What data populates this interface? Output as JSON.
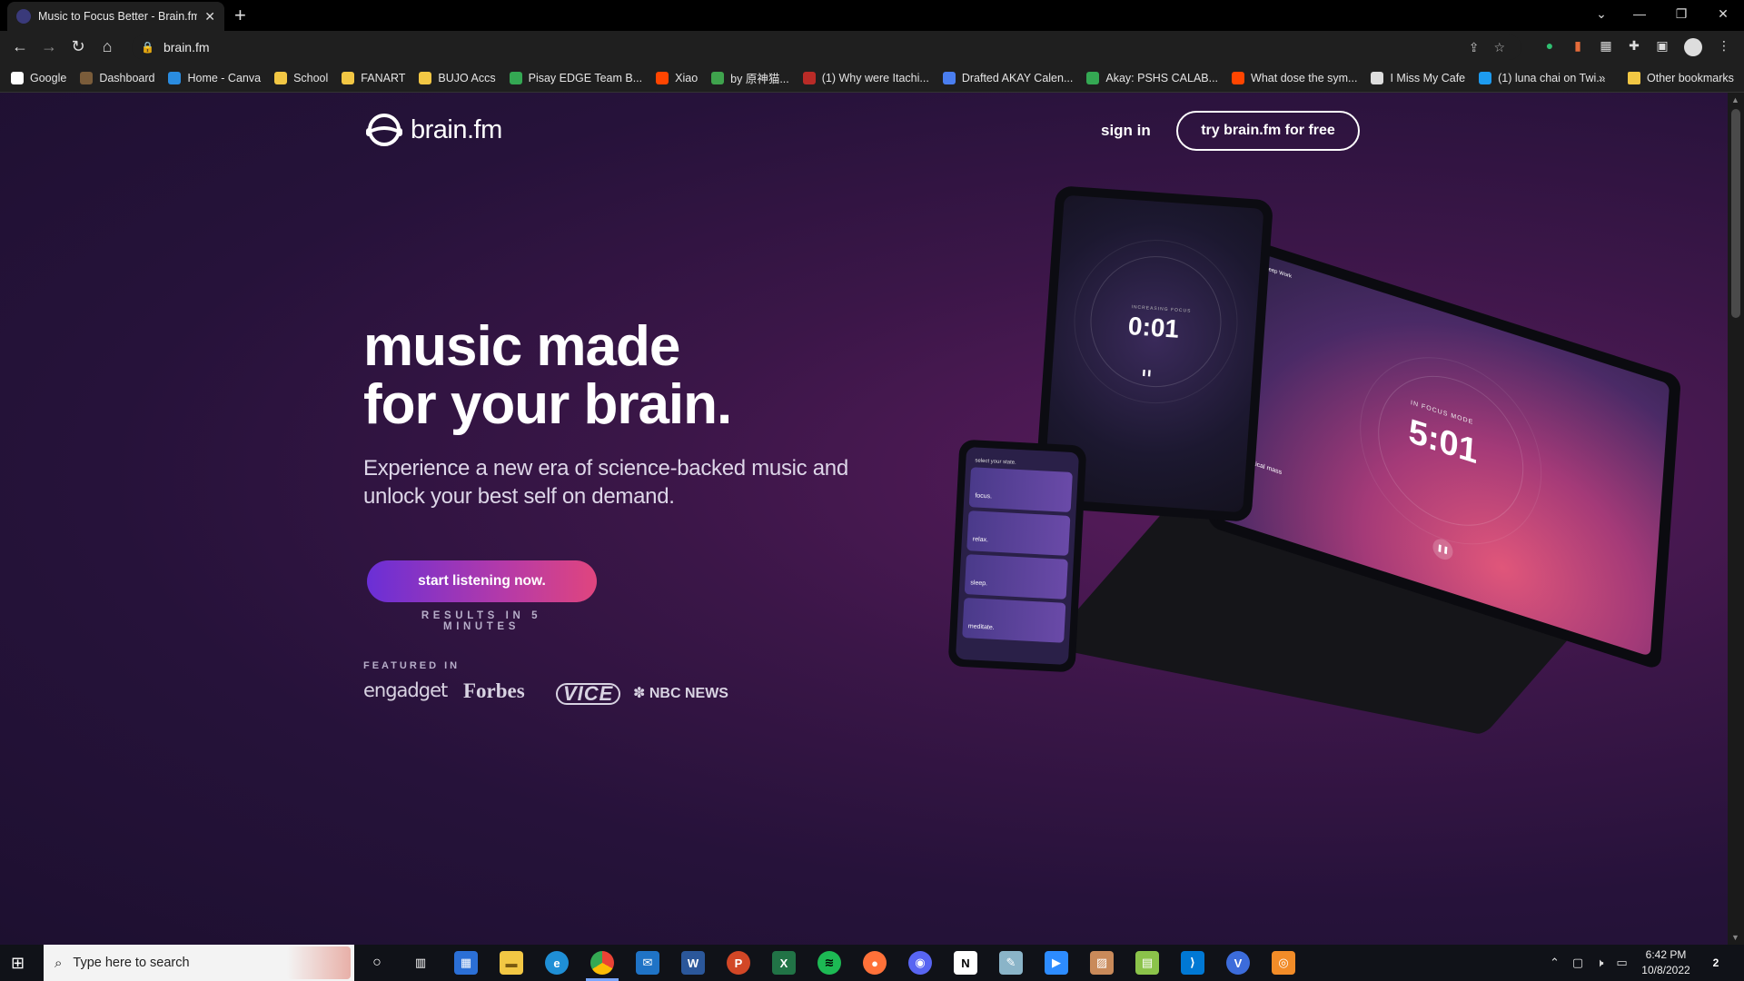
{
  "browser": {
    "tab_title": "Music to Focus Better - Brain.fm",
    "tab_close": "✕",
    "new_tab": "+",
    "url": "brain.fm",
    "bookmarks": [
      {
        "label": "Google",
        "icon": "google-icon",
        "color": "#ffffff"
      },
      {
        "label": "Dashboard",
        "icon": "dashboard-icon",
        "color": "#7a5c3a"
      },
      {
        "label": "Home - Canva",
        "icon": "canva-icon",
        "color": "#2a8ce0"
      },
      {
        "label": "School",
        "icon": "folder-icon",
        "color": "#f2c744"
      },
      {
        "label": "FANART",
        "icon": "folder-icon",
        "color": "#f2c744"
      },
      {
        "label": "BUJO Accs",
        "icon": "folder-icon",
        "color": "#f2c744"
      },
      {
        "label": "Pisay EDGE Team B...",
        "icon": "drive-icon",
        "color": "#34a853"
      },
      {
        "label": "Xiao",
        "icon": "reddit-icon",
        "color": "#ff4500"
      },
      {
        "label": "by 原神猫...",
        "icon": "leaf-icon",
        "color": "#3fa34d"
      },
      {
        "label": "(1) Why were Itachi...",
        "icon": "quora-icon",
        "color": "#b92b27"
      },
      {
        "label": "Drafted AKAY Calen...",
        "icon": "docs-icon",
        "color": "#4a7ef0"
      },
      {
        "label": "Akay: PSHS CALAB...",
        "icon": "drive-icon",
        "color": "#34a853"
      },
      {
        "label": "What dose the sym...",
        "icon": "reddit-icon",
        "color": "#ff4500"
      },
      {
        "label": "I Miss My Cafe",
        "icon": "game-icon",
        "color": "#dddddd"
      },
      {
        "label": "(1) luna chai on Twi...",
        "icon": "twitter-icon",
        "color": "#1d9bf0"
      }
    ],
    "bookmarks_overflow": "»",
    "other_bookmarks": "Other bookmarks"
  },
  "page": {
    "logo_text": "brain.fm",
    "sign_in": "sign in",
    "try_button": "try brain.fm for free",
    "headline_line1": "music made",
    "headline_line2": "for your brain.",
    "subhead": "Experience a new era of science-backed music and unlock your best self on demand.",
    "cta": "start listening now.",
    "results": "RESULTS IN 5 MINUTES",
    "featured_in": "FEATURED IN",
    "press": [
      "engadget",
      "Forbes",
      "VICE",
      "NBC NEWS"
    ],
    "devices": {
      "tablet_label": "INCREASING FOCUS",
      "tablet_timer": "0:01",
      "laptop_label": "IN FOCUS MODE",
      "laptop_timer": "5:01",
      "laptop_track": "2 critical mass",
      "laptop_mode": "Deep Work",
      "phone_title": "select your state.",
      "phone_cards": [
        "focus.",
        "relax.",
        "sleep.",
        "meditate."
      ]
    }
  },
  "taskbar": {
    "search_placeholder": "Type here to search",
    "time": "6:42 PM",
    "date": "10/8/2022",
    "notification_count": "2"
  }
}
